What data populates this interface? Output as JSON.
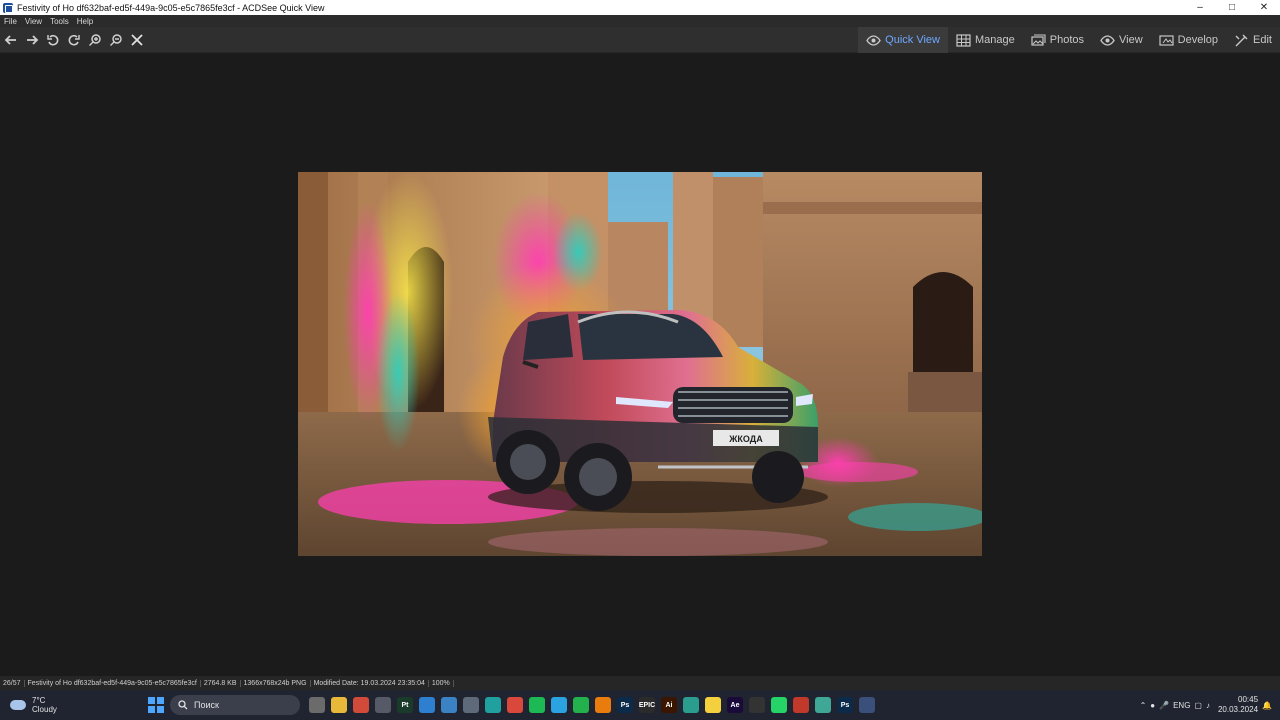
{
  "window": {
    "title": "Festivity of Ho df632baf-ed5f-449a-9c05-e5c7865fe3cf - ACDSee Quick View"
  },
  "menu": [
    "File",
    "View",
    "Tools",
    "Help"
  ],
  "modes": [
    {
      "label": "Quick View",
      "icon": "eye-icon",
      "active": true
    },
    {
      "label": "Manage",
      "icon": "grid-icon"
    },
    {
      "label": "Photos",
      "icon": "photos-icon"
    },
    {
      "label": "View",
      "icon": "eye-icon"
    },
    {
      "label": "Develop",
      "icon": "develop-icon"
    },
    {
      "label": "Edit",
      "icon": "edit-icon"
    }
  ],
  "image": {
    "plate_text": "ЖКОДА"
  },
  "status": {
    "index": "26/57",
    "filename": "Festivity of Ho df632baf-ed5f-449a-9c05-e5c7865fe3cf",
    "size": "2764.8 KB",
    "dimensions": "1366x768x24b PNG",
    "modified": "Modified Date: 19.03.2024 23:35:04",
    "zoom": "100%"
  },
  "taskbar": {
    "weather_temp": "7°C",
    "weather_desc": "Cloudy",
    "search_placeholder": "Поиск",
    "lang": "ENG",
    "time": "00:45",
    "date": "20.03.2024",
    "apps": [
      {
        "name": "taskview",
        "color": "#6b6b6b",
        "text": ""
      },
      {
        "name": "explorer",
        "color": "#e8b83a",
        "text": ""
      },
      {
        "name": "video",
        "color": "#d24b3a",
        "text": ""
      },
      {
        "name": "generic",
        "color": "#555a66",
        "text": ""
      },
      {
        "name": "pt",
        "color": "#1a3a2a",
        "text": "Pt"
      },
      {
        "name": "vscode-like",
        "color": "#2f7fd0",
        "text": ""
      },
      {
        "name": "store",
        "color": "#3b82c4",
        "text": ""
      },
      {
        "name": "calc",
        "color": "#5e6a7a",
        "text": ""
      },
      {
        "name": "tool",
        "color": "#21a0a0",
        "text": ""
      },
      {
        "name": "chrome",
        "color": "#d9483b",
        "text": ""
      },
      {
        "name": "spotify",
        "color": "#1db954",
        "text": ""
      },
      {
        "name": "telegram",
        "color": "#2aa3e0",
        "text": ""
      },
      {
        "name": "xbox",
        "color": "#22b14c",
        "text": ""
      },
      {
        "name": "blender",
        "color": "#e87d0d",
        "text": ""
      },
      {
        "name": "ps",
        "color": "#0c2a4a",
        "text": "Ps"
      },
      {
        "name": "epic",
        "color": "#2b2b2b",
        "text": "EPIC"
      },
      {
        "name": "ai",
        "color": "#3a1600",
        "text": "Ai"
      },
      {
        "name": "chat",
        "color": "#2a9d8f",
        "text": ""
      },
      {
        "name": "miro",
        "color": "#f4d03f",
        "text": ""
      },
      {
        "name": "ae",
        "color": "#1a0a3a",
        "text": "Ae"
      },
      {
        "name": "obs",
        "color": "#333",
        "text": ""
      },
      {
        "name": "whatsapp",
        "color": "#25d366",
        "text": ""
      },
      {
        "name": "photos",
        "color": "#c0392b",
        "text": ""
      },
      {
        "name": "notes",
        "color": "#3fa796",
        "text": ""
      },
      {
        "name": "ps2",
        "color": "#0c2a4a",
        "text": "Ps"
      },
      {
        "name": "acdsee",
        "color": "#3a4f7a",
        "text": ""
      }
    ]
  }
}
